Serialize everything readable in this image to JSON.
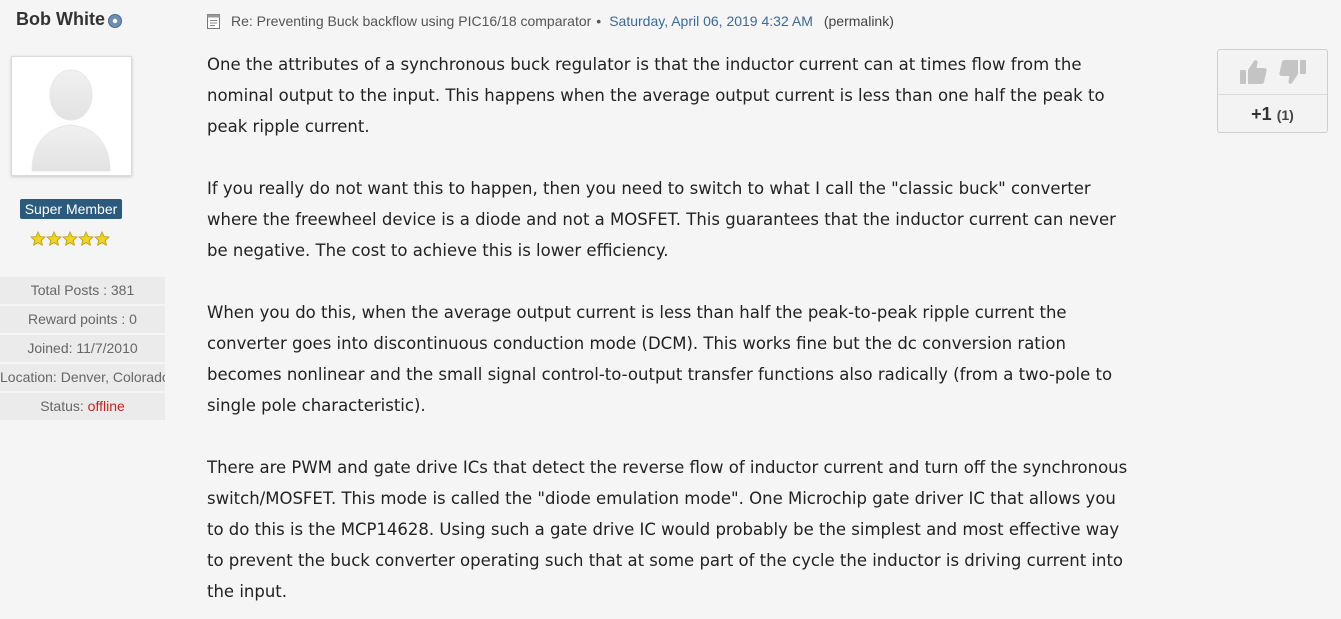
{
  "user": {
    "name": "Bob White",
    "rank": "Super Member",
    "stars": 5,
    "stats": {
      "total_posts": "Total Posts : 381",
      "reward_points": "Reward points : 0",
      "joined": "Joined: 11/7/2010",
      "location": "Location: Denver, Colorado",
      "status_label": "Status: ",
      "status_value": "offline"
    }
  },
  "post": {
    "title": "Re: Preventing Buck backflow using PIC16/18 comparator",
    "date": "Saturday, April 06, 2019 4:32 AM",
    "permalink": "(permalink)",
    "paragraphs": [
      "One the attributes of a synchronous buck regulator is that the inductor current can at times flow from the\nnominal output to the input.  This happens when the average output current is less than one half the peak to\npeak ripple current.",
      "If you really do not want this to happen, then you need to switch to what I call the \"classic buck\" converter\nwhere the freewheel device is a diode and not a MOSFET.  This guarantees that the inductor current can never\nbe negative.  The cost to achieve this is lower efficiency.",
      "When you do this, when the average output current is less than half the peak-to-peak ripple current the\nconverter goes into discontinuous conduction mode (DCM).  This works fine but the dc conversion ration\nbecomes nonlinear and the small signal control-to-output transfer functions also radically (from a two-pole to\nsingle pole characteristic).",
      "There are PWM and gate drive ICs that detect the reverse flow of inductor current and turn off the synchronous\nswitch/MOSFET.  This mode is called the \"diode emulation mode\".  One Microchip gate driver IC that allows you\nto do this is the MCP14628.  Using such a gate drive IC would probably be the simplest and most effective way\nto prevent the buck converter operating such that at some part of the cycle the inductor is driving current into\nthe input."
    ]
  },
  "votes": {
    "score": "+1",
    "count": "(1)"
  },
  "icons": {
    "post": "document-icon",
    "up": "thumbs-up-icon",
    "down": "thumbs-down-icon",
    "online": "user-info-icon",
    "star": "star-icon"
  },
  "colors": {
    "rank_badge": "#2a5a7c",
    "date_link": "#3a6a9a",
    "offline": "#cc1f1f",
    "stars": "#f2d21b"
  }
}
